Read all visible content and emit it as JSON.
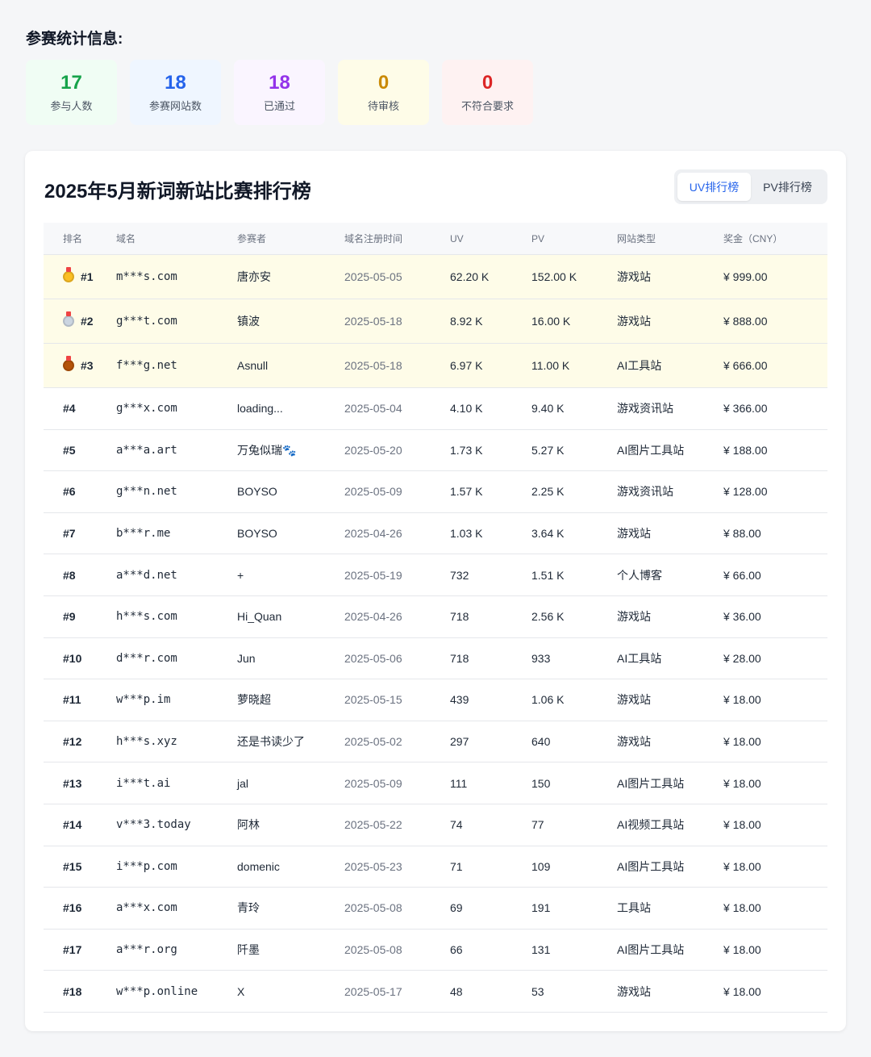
{
  "stats": {
    "title": "参赛统计信息:",
    "cards": [
      {
        "value": "17",
        "label": "参与人数",
        "color": "#16a34a",
        "bg": "#f0fdf4"
      },
      {
        "value": "18",
        "label": "参赛网站数",
        "color": "#2563eb",
        "bg": "#eff6ff"
      },
      {
        "value": "18",
        "label": "已通过",
        "color": "#9333ea",
        "bg": "#faf5ff"
      },
      {
        "value": "0",
        "label": "待审核",
        "color": "#ca8a04",
        "bg": "#fefce8"
      },
      {
        "value": "0",
        "label": "不符合要求",
        "color": "#dc2626",
        "bg": "#fef2f2"
      }
    ]
  },
  "board": {
    "title": "2025年5月新词新站比赛排行榜",
    "tabs": [
      {
        "label": "UV排行榜",
        "active": true
      },
      {
        "label": "PV排行榜",
        "active": false
      }
    ],
    "columns": [
      "排名",
      "域名",
      "参赛者",
      "域名注册时间",
      "UV",
      "PV",
      "网站类型",
      "奖金（CNY）"
    ],
    "rows": [
      {
        "rank": "#1",
        "medal": "gold",
        "domain": "m***s.com",
        "player": "唐亦安",
        "date": "2025-05-05",
        "uv": "62.20 K",
        "pv": "152.00 K",
        "type": "游戏站",
        "prize": "¥ 999.00"
      },
      {
        "rank": "#2",
        "medal": "silver",
        "domain": "g***t.com",
        "player": "镇波",
        "date": "2025-05-18",
        "uv": "8.92 K",
        "pv": "16.00 K",
        "type": "游戏站",
        "prize": "¥ 888.00"
      },
      {
        "rank": "#3",
        "medal": "bronze",
        "domain": "f***g.net",
        "player": "Asnull",
        "date": "2025-05-18",
        "uv": "6.97 K",
        "pv": "11.00 K",
        "type": "AI工具站",
        "prize": "¥ 666.00"
      },
      {
        "rank": "#4",
        "domain": "g***x.com",
        "player": "loading...",
        "date": "2025-05-04",
        "uv": "4.10 K",
        "pv": "9.40 K",
        "type": "游戏资讯站",
        "prize": "¥ 366.00"
      },
      {
        "rank": "#5",
        "domain": "a***a.art",
        "player": "万兔似瑞🐾",
        "date": "2025-05-20",
        "uv": "1.73 K",
        "pv": "5.27 K",
        "type": "AI图片工具站",
        "prize": "¥ 188.00"
      },
      {
        "rank": "#6",
        "domain": "g***n.net",
        "player": "BOYSO",
        "date": "2025-05-09",
        "uv": "1.57 K",
        "pv": "2.25 K",
        "type": "游戏资讯站",
        "prize": "¥ 128.00"
      },
      {
        "rank": "#7",
        "domain": "b***r.me",
        "player": "BOYSO",
        "date": "2025-04-26",
        "uv": "1.03 K",
        "pv": "3.64 K",
        "type": "游戏站",
        "prize": "¥ 88.00"
      },
      {
        "rank": "#8",
        "domain": "a***d.net",
        "player": "+",
        "date": "2025-05-19",
        "uv": "732",
        "pv": "1.51 K",
        "type": "个人博客",
        "prize": "¥ 66.00"
      },
      {
        "rank": "#9",
        "domain": "h***s.com",
        "player": "Hi_Quan",
        "date": "2025-04-26",
        "uv": "718",
        "pv": "2.56 K",
        "type": "游戏站",
        "prize": "¥ 36.00"
      },
      {
        "rank": "#10",
        "domain": "d***r.com",
        "player": "Jun",
        "date": "2025-05-06",
        "uv": "718",
        "pv": "933",
        "type": "AI工具站",
        "prize": "¥ 28.00"
      },
      {
        "rank": "#11",
        "domain": "w***p.im",
        "player": "萝晓超",
        "date": "2025-05-15",
        "uv": "439",
        "pv": "1.06 K",
        "type": "游戏站",
        "prize": "¥ 18.00"
      },
      {
        "rank": "#12",
        "domain": "h***s.xyz",
        "player": "还是书读少了",
        "date": "2025-05-02",
        "uv": "297",
        "pv": "640",
        "type": "游戏站",
        "prize": "¥ 18.00"
      },
      {
        "rank": "#13",
        "domain": "i***t.ai",
        "player": "jal",
        "date": "2025-05-09",
        "uv": "111",
        "pv": "150",
        "type": "AI图片工具站",
        "prize": "¥ 18.00"
      },
      {
        "rank": "#14",
        "domain": "v***3.today",
        "player": "阿林",
        "date": "2025-05-22",
        "uv": "74",
        "pv": "77",
        "type": "AI视频工具站",
        "prize": "¥ 18.00"
      },
      {
        "rank": "#15",
        "domain": "i***p.com",
        "player": "domenic",
        "date": "2025-05-23",
        "uv": "71",
        "pv": "109",
        "type": "AI图片工具站",
        "prize": "¥ 18.00"
      },
      {
        "rank": "#16",
        "domain": "a***x.com",
        "player": "青玲",
        "date": "2025-05-08",
        "uv": "69",
        "pv": "191",
        "type": "工具站",
        "prize": "¥ 18.00"
      },
      {
        "rank": "#17",
        "domain": "a***r.org",
        "player": "阡墨",
        "date": "2025-05-08",
        "uv": "66",
        "pv": "131",
        "type": "AI图片工具站",
        "prize": "¥ 18.00"
      },
      {
        "rank": "#18",
        "domain": "w***p.online",
        "player": "X",
        "date": "2025-05-17",
        "uv": "48",
        "pv": "53",
        "type": "游戏站",
        "prize": "¥ 18.00"
      }
    ]
  }
}
